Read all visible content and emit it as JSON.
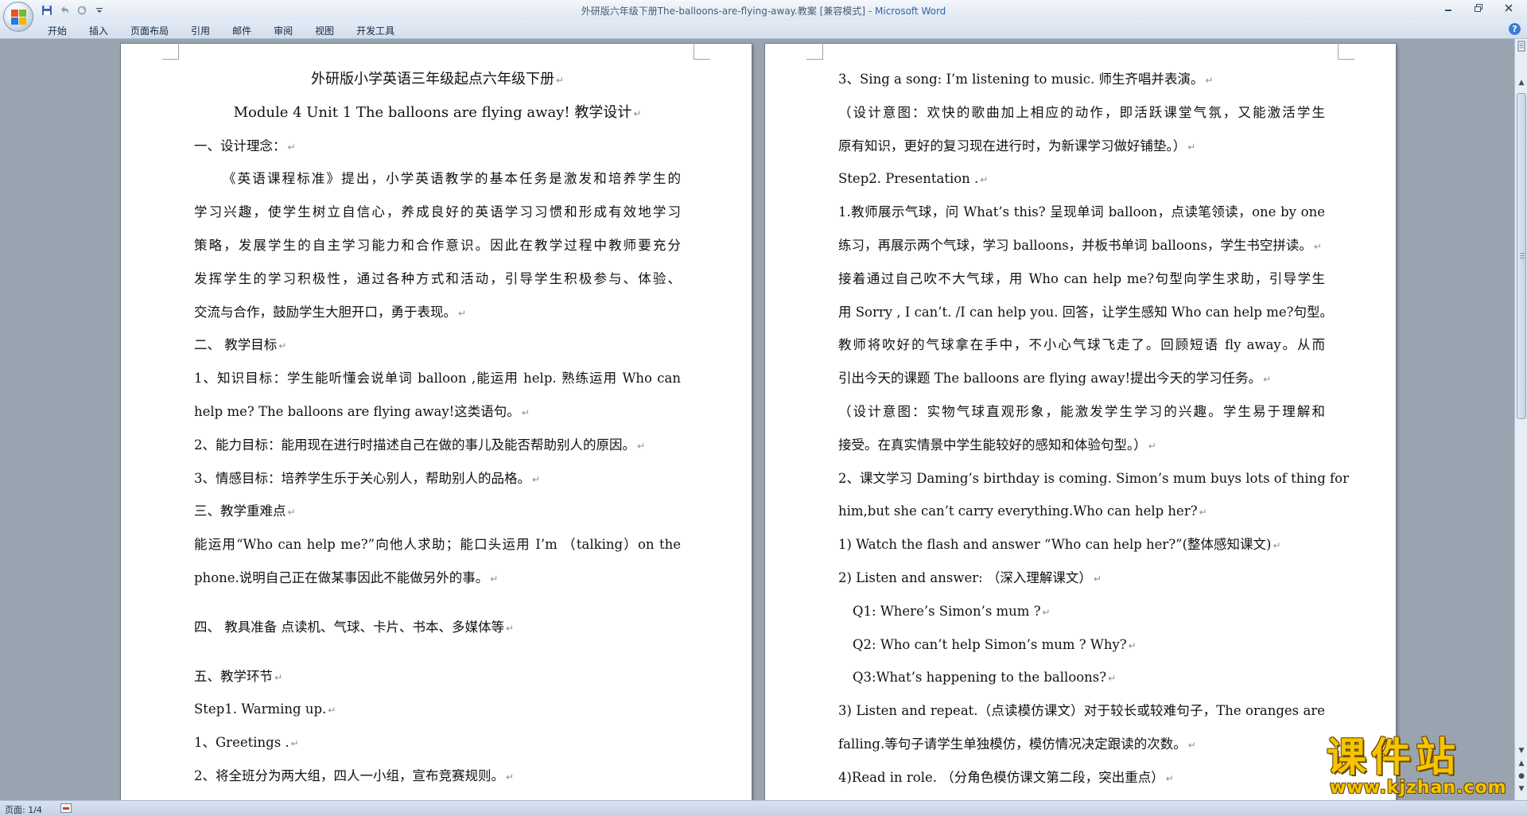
{
  "window": {
    "doc_title": "外研版六年级下册The-balloons-are-flying-away.教案 [兼容模式] - ",
    "app_name": "Microsoft Word"
  },
  "quick_access": [
    "save-icon",
    "undo-icon",
    "redo-icon",
    "customize-icon"
  ],
  "ribbon": {
    "tabs": [
      "开始",
      "插入",
      "页面布局",
      "引用",
      "邮件",
      "审阅",
      "视图",
      "开发工具"
    ]
  },
  "page1": {
    "title1": "外研版小学英语三年级起点六年级下册",
    "title2": "Module 4 Unit 1 The balloons are flying away!  教学设计",
    "lines": [
      "一、设计理念：",
      "《英语课程标准》提出，小学英语教学的基本任务是激发和培养学生的",
      "学习兴趣，使学生树立自信心，养成良好的英语学习习惯和形成有效地学习",
      "策略，发展学生的自主学习能力和合作意识。因此在教学过程中教师要充分",
      "发挥学生的学习积极性，通过各种方式和活动，引导学生积极参与、体验、",
      "交流与合作，鼓励学生大胆开口，勇于表现。",
      "二、  教学目标",
      "1、知识目标：学生能听懂会说单词 balloon ,能运用 help. 熟练运用 Who can",
      "help me? The balloons are flying away!这类语句。",
      "2、能力目标：能用现在进行时描述自己在做的事儿及能否帮助别人的原因。",
      "3、情感目标：培养学生乐于关心别人，帮助别人的品格。",
      "三、教学重难点",
      "能运用“Who  can  help  me?”向他人求助；能口头运用 I’m  （talking）on  the",
      "phone.说明自己正在做某事因此不能做另外的事。",
      "四、  教具准备    点读机、气球、卡片、书本、多媒体等",
      "五、教学环节",
      "Step1. Warming up.",
      "1、Greetings .",
      "2、将全班分为两大组，四人一小组，宣布竞赛规则。"
    ]
  },
  "page2": {
    "lines": [
      "3、Sing a song: I’m listening to music.  师生齐唱并表演。",
      "（设计意图：欢快的歌曲加上相应的动作，即活跃课堂气氛，又能激活学生",
      "原有知识，更好的复习现在进行时，为新课学习做好铺垫。）",
      "Step2. Presentation .",
      "1.教师展示气球，问 What’s this?  呈现单词  balloon，点读笔领读，one by one",
      "练习，再展示两个气球，学习 balloons，并板书单词 balloons，学生书空拼读。",
      "接着通过自己吹不大气球，用 Who can help me?句型向学生求助，引导学生",
      "用 Sorry , I can’t. /I can help you.  回答，让学生感知 Who can help me?句型。",
      "教师将吹好的气球拿在手中，不小心气球飞走了。回顾短语  fly away。从而",
      "引出今天的课题 The balloons are flying away!提出今天的学习任务。",
      "（设计意图：实物气球直观形象，能激发学生学习的兴趣。学生易于理解和",
      "接受。在真实情景中学生能较好的感知和体验句型。）",
      "2、课文学习  Daming’s birthday is coming. Simon’s mum buys lots of thing for",
      "him,but she can’t carry everything.Who can help her?",
      "1) Watch the flash and answer “Who can help her?”(整体感知课文)",
      "2) Listen and answer:  （深入理解课文）",
      "Q1: Where’s Simon’s mum ?",
      "Q2: Who can’t help Simon’s mum ? Why?",
      "Q3:What’s happening to the balloons?",
      "3) Listen and repeat.（点读模仿课文）对于较长或较难句子，The oranges are",
      "falling.等句子请学生单独模仿，模仿情况决定跟读的次数。",
      "4)Read in role.  （分角色模仿课文第二段，突出重点）"
    ]
  },
  "status": {
    "page": "页面: 1/4"
  },
  "watermark": {
    "title": "课件站",
    "url": "www.kjzhan.com"
  },
  "help_label": "?"
}
